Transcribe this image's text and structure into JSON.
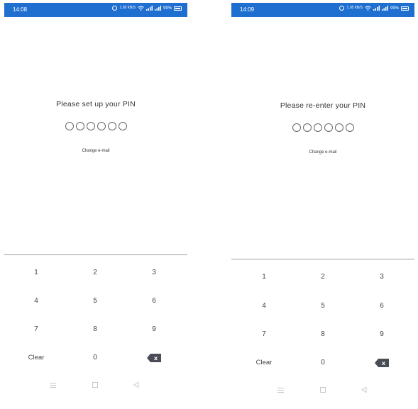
{
  "screens": [
    {
      "status_bar": {
        "time": "14:08",
        "network": "1.38 KB/S",
        "battery_percent": "99%"
      },
      "title": "Please set up your PIN",
      "pin_slots": 6,
      "change_email_link": "Change e-mail",
      "keypad": {
        "keys": [
          "1",
          "2",
          "3",
          "4",
          "5",
          "6",
          "7",
          "8",
          "9"
        ],
        "clear_label": "Clear",
        "zero_label": "0",
        "backspace_glyph": "x"
      }
    },
    {
      "status_bar": {
        "time": "14:09",
        "network": "1.38 KB/S",
        "battery_percent": "99%"
      },
      "title": "Please re-enter your PIN",
      "pin_slots": 6,
      "change_email_link": "Change e-mail",
      "keypad": {
        "keys": [
          "1",
          "2",
          "3",
          "4",
          "5",
          "6",
          "7",
          "8",
          "9"
        ],
        "clear_label": "Clear",
        "zero_label": "0",
        "backspace_glyph": "x"
      }
    }
  ],
  "colors": {
    "status_bar": "#1f6fd1",
    "backspace_key": "#4a4d55",
    "divider": "#9a9a9a",
    "nav_icons": "#c8c8c8"
  },
  "icons": {
    "menu": "menu-icon",
    "home": "home-square-icon",
    "back": "back-triangle-icon",
    "wifi": "wifi-icon",
    "signal": "signal-icon",
    "battery": "battery-icon"
  }
}
